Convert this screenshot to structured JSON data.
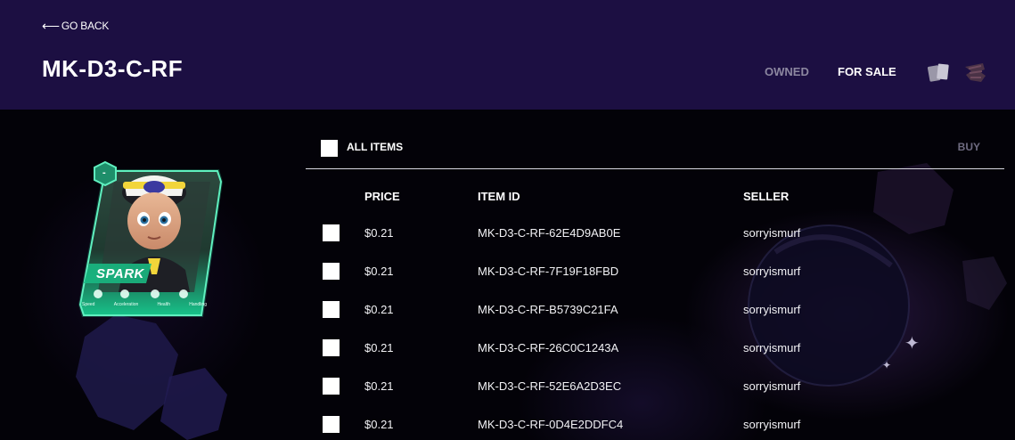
{
  "header": {
    "go_back": "GO BACK",
    "title": "MK-D3-C-RF",
    "tabs": [
      {
        "label": "OWNED",
        "active": false
      },
      {
        "label": "FOR SALE",
        "active": true
      }
    ],
    "view_icons": [
      "cards-view-icon",
      "list-view-icon"
    ]
  },
  "card": {
    "name": "SPARK",
    "badge": "-",
    "stats": [
      "Speed",
      "Acceleration",
      "Health",
      "Handling"
    ]
  },
  "table": {
    "all_items_label": "ALL ITEMS",
    "buy_label": "BUY",
    "columns": [
      "PRICE",
      "ITEM ID",
      "SELLER"
    ],
    "rows": [
      {
        "price": "$0.21",
        "item_id": "MK-D3-C-RF-62E4D9AB0E",
        "seller": "sorryismurf"
      },
      {
        "price": "$0.21",
        "item_id": "MK-D3-C-RF-7F19F18FBD",
        "seller": "sorryismurf"
      },
      {
        "price": "$0.21",
        "item_id": "MK-D3-C-RF-B5739C21FA",
        "seller": "sorryismurf"
      },
      {
        "price": "$0.21",
        "item_id": "MK-D3-C-RF-26C0C1243A",
        "seller": "sorryismurf"
      },
      {
        "price": "$0.21",
        "item_id": "MK-D3-C-RF-52E6A2D3EC",
        "seller": "sorryismurf"
      },
      {
        "price": "$0.21",
        "item_id": "MK-D3-C-RF-0D4E2DDFC4",
        "seller": "sorryismurf"
      }
    ]
  },
  "colors": {
    "header_bg": "#1c0f42",
    "page_bg": "#050309",
    "card_accent": "#2fd29a",
    "muted_text": "#8c87a0"
  }
}
